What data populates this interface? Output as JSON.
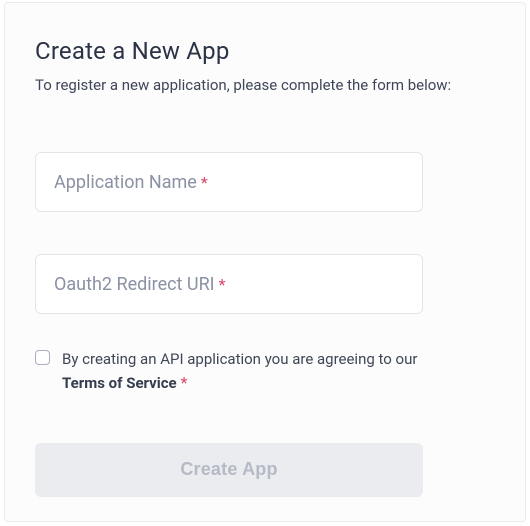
{
  "header": {
    "title": "Create a New App",
    "subtitle": "To register a new application, please complete the form below:"
  },
  "form": {
    "app_name": {
      "placeholder": "Application Name",
      "value": "",
      "required_mark": "*"
    },
    "redirect_uri": {
      "placeholder": "Oauth2 Redirect URI",
      "value": "",
      "required_mark": "*"
    },
    "agree": {
      "checked": false,
      "text_prefix": "By creating an API application you are agreeing to our ",
      "tos_label": "Terms of Service",
      "required_mark": "*"
    },
    "submit_label": "Create App"
  }
}
